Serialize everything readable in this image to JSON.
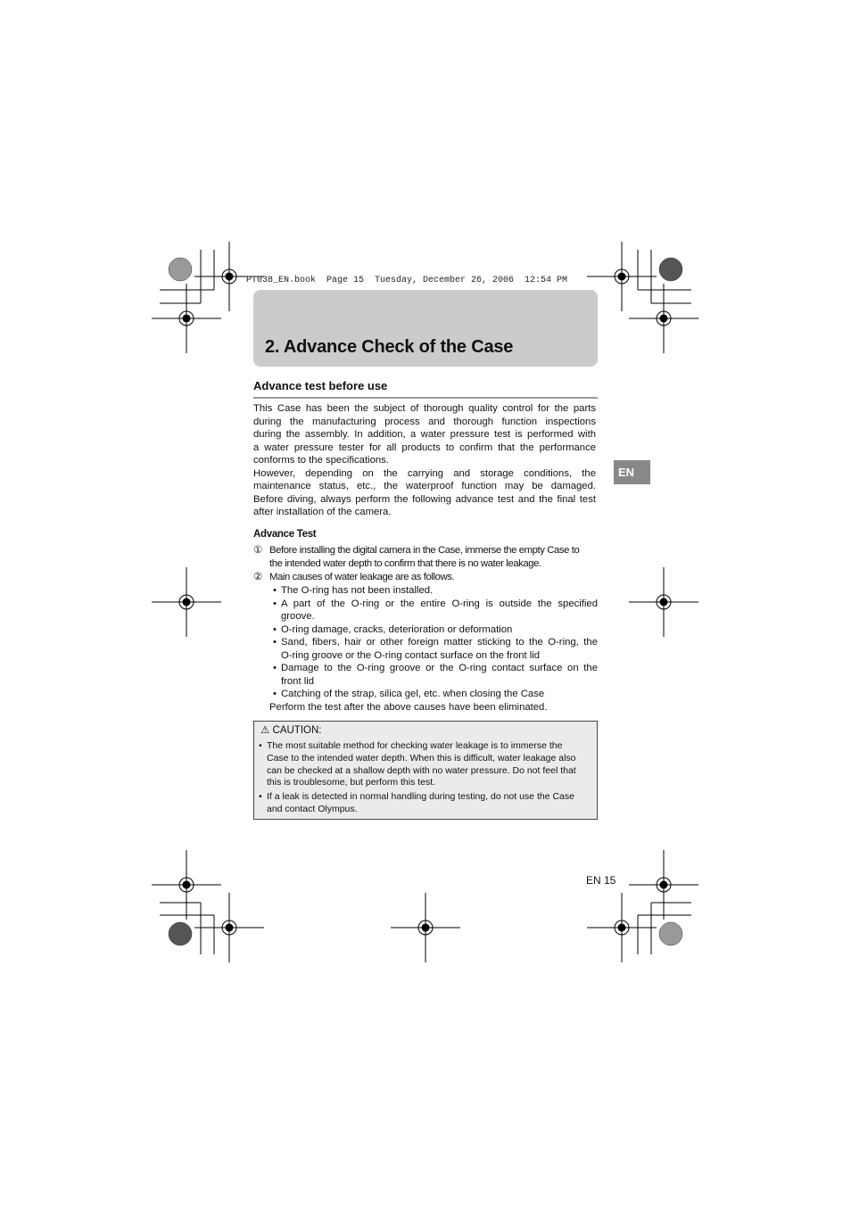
{
  "slug": "PT038_EN.book  Page 15  Tuesday, December 26, 2006  12:54 PM",
  "title": "2. Advance Check of the Case",
  "section_heading": "Advance test before use",
  "intro_lines": [
    "This Case has been the subject of thorough quality control for the parts",
    "during the manufacturing process and thorough function inspections",
    "during the assembly. In addition, a water pressure test is performed with",
    "a water pressure tester for all products to confirm that the performance",
    "conforms to the specifications.",
    "However, depending on the carrying and storage conditions, the",
    "maintenance status, etc., the waterproof function may be damaged.",
    "Before diving, always perform the following advance test and the final test",
    "after installation of the camera."
  ],
  "language_tab": "EN",
  "subheading": "Advance Test",
  "steps": [
    {
      "marker": "①",
      "lines": [
        "Before installing the digital camera in the Case, immerse the empty Case to",
        "the intended water depth to confirm that there is no water leakage."
      ]
    },
    {
      "marker": "②",
      "lines": [
        "Main causes of water leakage are as follows."
      ]
    }
  ],
  "causes": [
    [
      "The O-ring has not been installed."
    ],
    [
      "A part of the O-ring or the entire O-ring is outside the specified",
      "groove."
    ],
    [
      "O-ring damage, cracks, deterioration or deformation"
    ],
    [
      "Sand, fibers, hair or other foreign matter sticking to the O-ring, the",
      "O-ring groove or the O-ring contact surface on the front lid"
    ],
    [
      "Damage to the O-ring groove or the O-ring contact surface on the",
      "front lid"
    ],
    [
      "Catching of the strap, silica gel, etc. when closing the Case"
    ]
  ],
  "closing_line": "Perform the test after the above causes have been eliminated.",
  "caution": {
    "icon": "warning-triangle-icon",
    "label": "CAUTION:",
    "items": [
      [
        "The most suitable method for checking water leakage is to immerse the",
        "Case to the intended water depth. When this is difficult, water leakage also",
        "can be checked at a shallow depth with no water pressure. Do not feel that",
        "this is troublesome, but perform this test."
      ],
      [
        "If a leak is detected in normal handling during testing, do not use the Case",
        "and contact Olympus."
      ]
    ]
  },
  "page_number": "EN 15",
  "colors": {
    "title_box": "#cbcbcb",
    "rule": "#9a9a9a",
    "tab": "#888888",
    "caution_bg": "#ebebeb"
  }
}
